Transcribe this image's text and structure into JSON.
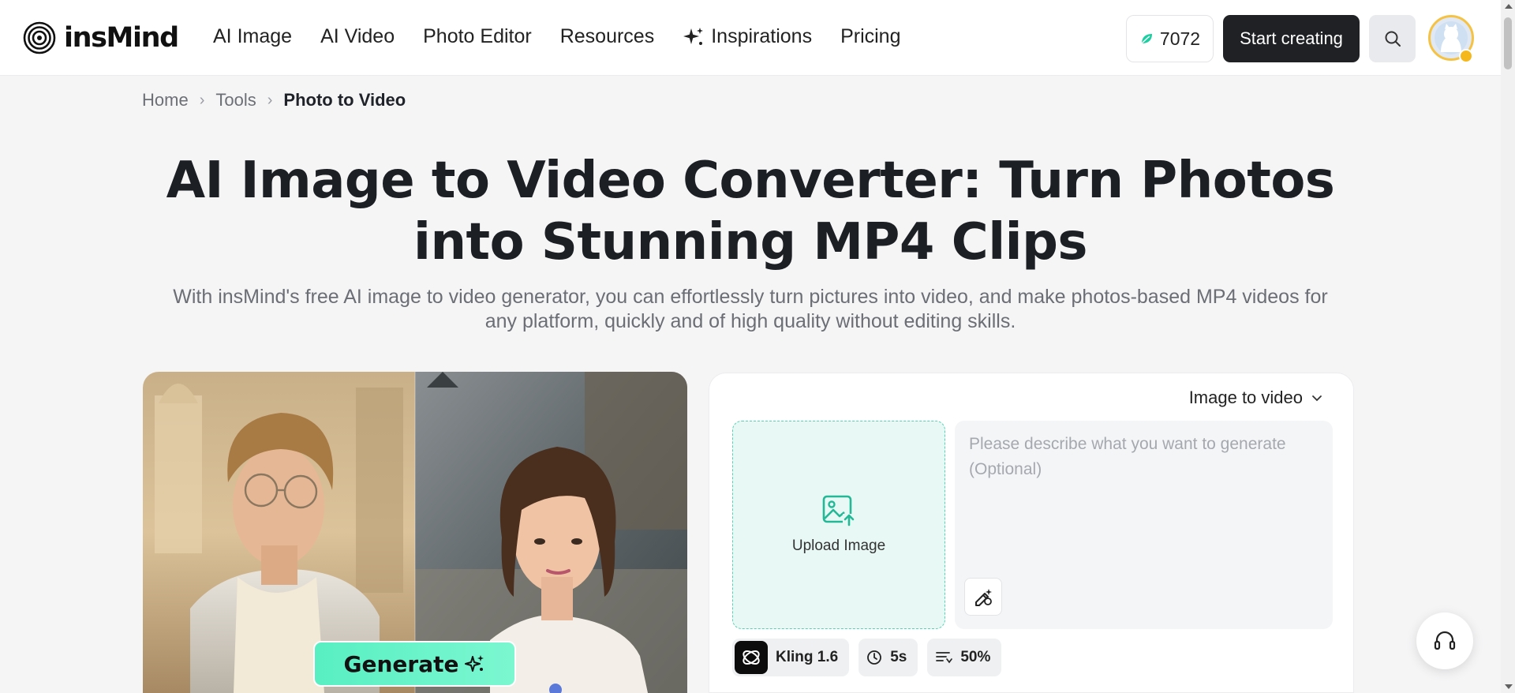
{
  "brand": {
    "name": "insMind"
  },
  "nav": {
    "items": [
      {
        "label": "AI Image"
      },
      {
        "label": "AI Video"
      },
      {
        "label": "Photo Editor"
      },
      {
        "label": "Resources"
      },
      {
        "label": "Inspirations",
        "icon": "sparkle-icon"
      },
      {
        "label": "Pricing"
      }
    ]
  },
  "header": {
    "credits": "7072",
    "start_label": "Start creating"
  },
  "breadcrumb": {
    "items": [
      "Home",
      "Tools"
    ],
    "current": "Photo to Video"
  },
  "hero": {
    "title": "AI Image to Video Converter: Turn Photos into Stunning MP4 Clips",
    "subtitle": "With insMind's free AI image to video generator, you can effortlessly turn pictures into video, and make photos-based MP4 videos for any platform, quickly and of high quality without editing skills."
  },
  "preview": {
    "generate_label": "Generate"
  },
  "tool": {
    "mode": "Image to video",
    "upload_label": "Upload Image",
    "prompt_placeholder": "Please describe what you want to generate (Optional)",
    "prompt_value": "",
    "model": "Kling 1.6",
    "duration": "5s",
    "strength": "50%"
  },
  "colors": {
    "accent": "#58efc2",
    "upload_bg": "#e8f8f5",
    "dark_button": "#1f2124"
  }
}
